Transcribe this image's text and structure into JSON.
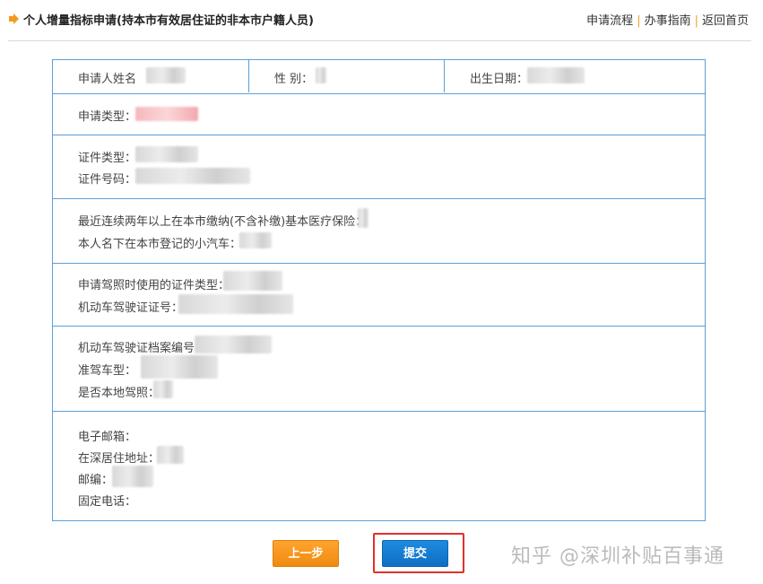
{
  "header": {
    "title": "个人增量指标申请(持本市有效居住证的非本市户籍人员)",
    "links": [
      "申请流程",
      "办事指南",
      "返回首页"
    ]
  },
  "form": {
    "row1": {
      "name_label": "申请人姓名",
      "gender_label": "性 别：",
      "birth_label": "出生日期："
    },
    "application_type_label": "申请类型：",
    "id_type_label": "证件类型：",
    "id_number_label": "证件号码：",
    "insurance_label": "最近连续两年以上在本市缴纳(不含补缴)基本医疗保险：",
    "car_label": "本人名下在本市登记的小汽车：",
    "license_id_type_label": "申请驾照时使用的证件类型：",
    "license_number_label": "机动车驾驶证证号：",
    "license_file_label": "机动车驾驶证档案编号：",
    "vehicle_class_label": "准驾车型：",
    "local_license_label": "是否本地驾照：",
    "email_label": "电子邮箱：",
    "address_label": "在深居住地址：",
    "postcode_label": "邮编：",
    "phone_label": "固定电话："
  },
  "buttons": {
    "prev_label": "上一步",
    "submit_label": "提交"
  },
  "watermark": "知乎 @深圳补贴百事通",
  "colors": {
    "border_blue": "#5aa0d8",
    "prev_orange": "#f7941d",
    "submit_blue": "#1a7fd4",
    "highlight_red": "#e0302a",
    "separator_orange": "#f0a020"
  }
}
